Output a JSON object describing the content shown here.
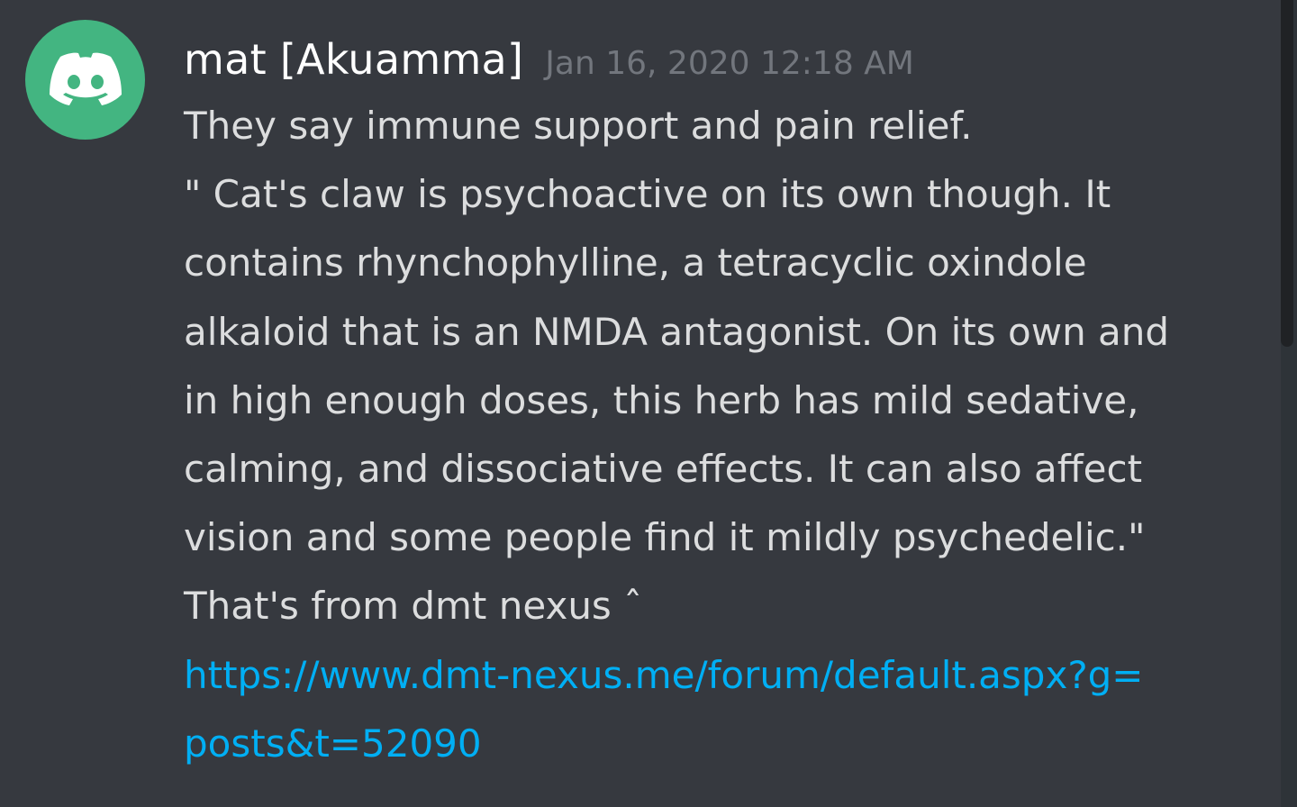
{
  "message": {
    "author": "mat [Akuamma]",
    "timestamp": "Jan 16, 2020 12:18 AM",
    "avatar_icon": "discord-logo-icon",
    "avatar_color": "#43b581",
    "lines": [
      "They say immune support and pain relief.",
      "\" Cat's claw is psychoactive on its own though. It",
      "contains rhynchophylline, a tetracyclic oxindole",
      "alkaloid that is an NMDA antagonist. On its own and",
      "in high enough doses, this herb has mild sedative,",
      "calming, and dissociative effects. It can also affect",
      "vision and some people find it mildly psychedelic.\"",
      "That's from dmt nexus ˆ"
    ],
    "link_lines": [
      "https://www.dmt-nexus.me/forum/default.aspx?g=",
      "posts&t=52090"
    ],
    "link_color": "#00aff4"
  }
}
